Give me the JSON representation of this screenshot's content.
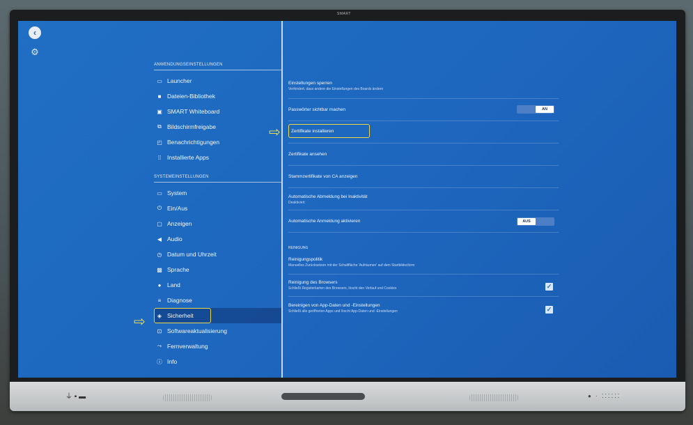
{
  "device": {
    "brand": "SMART"
  },
  "nav": {
    "app_section": "ANWENDUNGSEINSTELLUNGEN",
    "app_items": [
      {
        "label": "Launcher",
        "icon": "monitor-icon"
      },
      {
        "label": "Dateien-Bibliothek",
        "icon": "folder-icon"
      },
      {
        "label": "SMART Whiteboard",
        "icon": "whiteboard-icon"
      },
      {
        "label": "Bildschirmfreigabe",
        "icon": "screen-share-icon"
      },
      {
        "label": "Benachrichtigungen",
        "icon": "notification-icon"
      },
      {
        "label": "Installierte Apps",
        "icon": "apps-grid-icon"
      }
    ],
    "system_section": "SYSTEMEINSTELLUNGEN",
    "system_items": [
      {
        "label": "System",
        "icon": "monitor-icon"
      },
      {
        "label": "Ein/Aus",
        "icon": "power-icon"
      },
      {
        "label": "Anzeigen",
        "icon": "display-icon"
      },
      {
        "label": "Audio",
        "icon": "speaker-icon"
      },
      {
        "label": "Datum und Uhrzeit",
        "icon": "clock-icon"
      },
      {
        "label": "Sprache",
        "icon": "language-icon"
      },
      {
        "label": "Land",
        "icon": "location-pin-icon"
      },
      {
        "label": "Diagnose",
        "icon": "list-icon"
      },
      {
        "label": "Sicherheit",
        "icon": "shield-icon",
        "active": true
      },
      {
        "label": "Softwareaktualisierung",
        "icon": "update-icon"
      },
      {
        "label": "Fernverwaltung",
        "icon": "remote-icon"
      },
      {
        "label": "Info",
        "icon": "info-icon"
      }
    ]
  },
  "settings": {
    "lock": {
      "title": "Einstellungen sperren",
      "sub": "Verhindert, dass andere die Einstellungen des Boards ändern"
    },
    "passwords": {
      "title": "Passwörter sichtbar machen",
      "toggle": "AN"
    },
    "install_certs": {
      "title": "Zertifikate installieren"
    },
    "view_certs": {
      "title": "Zertifikate ansehen"
    },
    "root_certs": {
      "title": "Stammzertifikate von CA anzeigen"
    },
    "auto_logout": {
      "title": "Automatische Abmeldung bei Inaktivität",
      "sub": "Deaktiviert"
    },
    "auto_login": {
      "title": "Automatische Anmeldung aktivieren",
      "toggle": "AUS"
    },
    "cleaning_section": "REINIGUNG",
    "cleaning_policy": {
      "title": "Reinigungspolitik",
      "sub": "Manuelles Zurücksetzen mit der Schaltfläche 'Aufräumen' auf dem Startbildschirm"
    },
    "browser_cleaning": {
      "title": "Reinigung des Browsers",
      "sub": "Schließt Registerkarten des Browsers, löscht den Verlauf und Cookies",
      "checked": true
    },
    "app_cleaning": {
      "title": "Bereinigen von App-Daten und -Einstellungen",
      "sub": "Schließt alle geöffneten Apps und löscht App-Daten und -Einstellungen",
      "checked": true
    }
  },
  "colors": {
    "screen": "#1e67bf",
    "highlight": "#f0d84a"
  }
}
